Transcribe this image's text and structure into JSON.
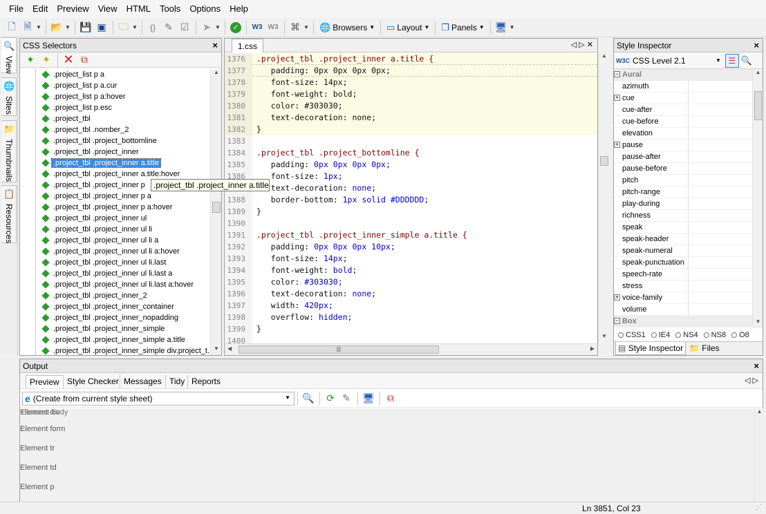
{
  "menu": [
    "File",
    "Edit",
    "Preview",
    "View",
    "HTML",
    "Tools",
    "Options",
    "Help"
  ],
  "toolbar": {
    "browsers": "Browsers",
    "layout": "Layout",
    "panels": "Panels",
    "braces": "{}"
  },
  "left_tabs": [
    "View",
    "Sites",
    "Thumbnails",
    "Resources"
  ],
  "css_panel": {
    "title": "CSS Selectors",
    "close": "×",
    "selectors": [
      ".project_list p a",
      ".project_list p a.cur",
      ".project_list p a:hover",
      ".project_list p.esc",
      ".project_tbl",
      ".project_tbl .nomber_2",
      ".project_tbl .project_bottomline",
      ".project_tbl .project_inner",
      ".project_tbl .project_inner a.title",
      ".project_tbl .project_inner a.title:hover",
      ".project_tbl .project_inner p",
      ".project_tbl .project_inner p a",
      ".project_tbl .project_inner p a:hover",
      ".project_tbl .project_inner ul",
      ".project_tbl .project_inner ul li",
      ".project_tbl .project_inner ul li a",
      ".project_tbl .project_inner ul li a:hover",
      ".project_tbl .project_inner ul li.last",
      ".project_tbl .project_inner ul li.last a",
      ".project_tbl .project_inner ul li.last a:hover",
      ".project_tbl .project_inner_2",
      ".project_tbl .project_inner_container",
      ".project_tbl .project_inner_nopadding",
      ".project_tbl .project_inner_simple",
      ".project_tbl .project_inner_simple a.title",
      ".project_tbl .project_inner_simple div.project_t..."
    ],
    "selected_index": 8,
    "tooltip": ".project_tbl .project_inner a.title"
  },
  "editor": {
    "tab": "1.css",
    "lines": [
      {
        "n": "1376",
        "hl": true,
        "dash": true,
        "parts": [
          [
            ".project_tbl .project_inner a.title {",
            "c-sel"
          ]
        ]
      },
      {
        "n": "1377",
        "hl": true,
        "dash": true,
        "parts": [
          [
            "   padding: 0px 0px 0px 0px;",
            "c-plain"
          ]
        ]
      },
      {
        "n": "1378",
        "hl": true,
        "parts": [
          [
            "   font-size: 14px;",
            "c-plain"
          ]
        ]
      },
      {
        "n": "1379",
        "hl": true,
        "parts": [
          [
            "   font-weight: bold;",
            "c-plain"
          ]
        ]
      },
      {
        "n": "1380",
        "hl": true,
        "parts": [
          [
            "   color: #303030;",
            "c-plain"
          ]
        ]
      },
      {
        "n": "1381",
        "hl": true,
        "parts": [
          [
            "   text-decoration: none;",
            "c-plain"
          ]
        ]
      },
      {
        "n": "1382",
        "hl": true,
        "parts": [
          [
            "}",
            "c-plain"
          ]
        ]
      },
      {
        "n": "1383",
        "parts": []
      },
      {
        "n": "1384",
        "parts": [
          [
            ".project_tbl .project_bottomline {",
            "c-sel"
          ]
        ]
      },
      {
        "n": "1385",
        "parts": [
          [
            "   padding: ",
            "c-prop"
          ],
          [
            "0px 0px 0px 0px;",
            "c-val"
          ]
        ]
      },
      {
        "n": "1386",
        "parts": [
          [
            "   font-size: ",
            "c-prop"
          ],
          [
            "1px;",
            "c-val"
          ]
        ]
      },
      {
        "n": "1387",
        "parts": [
          [
            "   text-decoration: ",
            "c-prop"
          ],
          [
            "none;",
            "c-val"
          ]
        ]
      },
      {
        "n": "1388",
        "parts": [
          [
            "   border-bottom: ",
            "c-prop"
          ],
          [
            "1px solid #DDDDDD;",
            "c-val"
          ]
        ]
      },
      {
        "n": "1389",
        "parts": [
          [
            "}",
            "c-plain"
          ]
        ]
      },
      {
        "n": "1390",
        "parts": []
      },
      {
        "n": "1391",
        "parts": [
          [
            ".project_tbl .project_inner_simple a.title {",
            "c-sel"
          ]
        ]
      },
      {
        "n": "1392",
        "parts": [
          [
            "   padding: ",
            "c-prop"
          ],
          [
            "0px 0px 0px 10px;",
            "c-val"
          ]
        ]
      },
      {
        "n": "1393",
        "parts": [
          [
            "   font-size: ",
            "c-prop"
          ],
          [
            "14px;",
            "c-val"
          ]
        ]
      },
      {
        "n": "1394",
        "parts": [
          [
            "   font-weight: ",
            "c-prop"
          ],
          [
            "bold;",
            "c-val"
          ]
        ]
      },
      {
        "n": "1395",
        "parts": [
          [
            "   color: ",
            "c-prop"
          ],
          [
            "#303030;",
            "c-val"
          ]
        ]
      },
      {
        "n": "1396",
        "parts": [
          [
            "   text-decoration: ",
            "c-prop"
          ],
          [
            "none;",
            "c-val"
          ]
        ]
      },
      {
        "n": "1397",
        "parts": [
          [
            "   width: ",
            "c-prop"
          ],
          [
            "420px;",
            "c-val"
          ]
        ]
      },
      {
        "n": "1398",
        "parts": [
          [
            "   overflow: ",
            "c-prop"
          ],
          [
            "hidden;",
            "c-val"
          ]
        ]
      },
      {
        "n": "1399",
        "parts": [
          [
            "}",
            "c-plain"
          ]
        ]
      },
      {
        "n": "1400",
        "parts": []
      }
    ]
  },
  "inspector": {
    "title": "Style Inspector",
    "close": "×",
    "level": "CSS Level 2.1",
    "rows": [
      {
        "type": "cat",
        "label": "Aural"
      },
      {
        "label": "azimuth"
      },
      {
        "label": "cue",
        "plus": true
      },
      {
        "label": "cue-after"
      },
      {
        "label": "cue-before"
      },
      {
        "label": "elevation"
      },
      {
        "label": "pause",
        "plus": true
      },
      {
        "label": "pause-after"
      },
      {
        "label": "pause-before"
      },
      {
        "label": "pitch"
      },
      {
        "label": "pitch-range"
      },
      {
        "label": "play-during"
      },
      {
        "label": "richness"
      },
      {
        "label": "speak"
      },
      {
        "label": "speak-header"
      },
      {
        "label": "speak-numeral"
      },
      {
        "label": "speak-punctuation"
      },
      {
        "label": "speech-rate"
      },
      {
        "label": "stress"
      },
      {
        "label": "voice-family",
        "plus": true
      },
      {
        "label": "volume"
      },
      {
        "type": "cat",
        "label": "Box"
      }
    ],
    "browsers": [
      "CSS1",
      "IE4",
      "NS4",
      "NS8",
      "O8"
    ],
    "tabs": [
      "Style Inspector",
      "Files"
    ]
  },
  "output": {
    "title": "Output",
    "close": "×",
    "tabs": [
      "Preview",
      "Style Checker",
      "Messages",
      "Tidy",
      "Reports"
    ],
    "select": "(Create from current style sheet)",
    "overlap_a": "Element div",
    "overlap_b": "Element body",
    "rows": [
      "Element form",
      "Element tr",
      "Element td",
      "Element p"
    ]
  },
  "status": {
    "position": "Ln 3851, Col 23"
  }
}
